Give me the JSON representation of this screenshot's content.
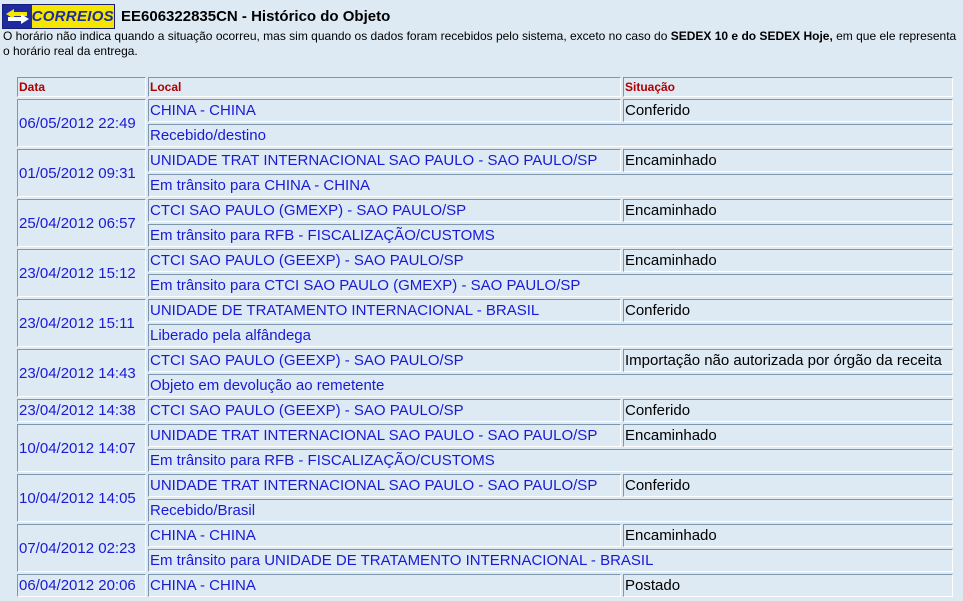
{
  "header": {
    "logo_text": "CORREIOS",
    "logo_colors": {
      "brand_blue": "#1d2aa0",
      "brand_yellow": "#f5e600"
    },
    "title": "EE606322835CN - Histórico do Objeto"
  },
  "note": {
    "text_1": "O horário não indica quando a situação ocorreu, mas sim quando os dados foram recebidos pelo sistema, exceto no caso do ",
    "bold": "SEDEX 10 e do SEDEX Hoje,",
    "text_2": " em que ele representa o horário real da entrega."
  },
  "table": {
    "headers": {
      "date": "Data",
      "location": "Local",
      "status": "Situação"
    },
    "rows": [
      {
        "date": "06/05/2012 22:49",
        "location": "CHINA - CHINA",
        "status": "Conferido",
        "detail": "Recebido/destino"
      },
      {
        "date": "01/05/2012 09:31",
        "location": "UNIDADE TRAT INTERNACIONAL SAO PAULO - SAO PAULO/SP",
        "status": "Encaminhado",
        "detail": "Em trânsito para CHINA - CHINA"
      },
      {
        "date": "25/04/2012 06:57",
        "location": "CTCI SAO PAULO (GMEXP) - SAO PAULO/SP",
        "status": "Encaminhado",
        "detail": "Em trânsito para RFB - FISCALIZAÇÃO/CUSTOMS"
      },
      {
        "date": "23/04/2012 15:12",
        "location": "CTCI SAO PAULO (GEEXP) - SAO PAULO/SP",
        "status": "Encaminhado",
        "detail": "Em trânsito para CTCI SAO PAULO (GMEXP) - SAO PAULO/SP"
      },
      {
        "date": "23/04/2012 15:11",
        "location": "UNIDADE DE TRATAMENTO INTERNACIONAL - BRASIL",
        "status": "Conferido",
        "detail": "Liberado pela alfândega"
      },
      {
        "date": "23/04/2012 14:43",
        "location": "CTCI SAO PAULO (GEEXP) - SAO PAULO/SP",
        "status": "Importação não autorizada por órgão da receita",
        "detail": "Objeto em devolução ao remetente"
      },
      {
        "date": "23/04/2012 14:38",
        "location": "CTCI SAO PAULO (GEEXP) - SAO PAULO/SP",
        "status": "Conferido",
        "detail": null
      },
      {
        "date": "10/04/2012 14:07",
        "location": "UNIDADE TRAT INTERNACIONAL SAO PAULO - SAO PAULO/SP",
        "status": "Encaminhado",
        "detail": "Em trânsito para RFB - FISCALIZAÇÃO/CUSTOMS"
      },
      {
        "date": "10/04/2012 14:05",
        "location": "UNIDADE TRAT INTERNACIONAL SAO PAULO - SAO PAULO/SP",
        "status": "Conferido",
        "detail": "Recebido/Brasil"
      },
      {
        "date": "07/04/2012 02:23",
        "location": "CHINA - CHINA",
        "status": "Encaminhado",
        "detail": "Em trânsito para UNIDADE DE TRATAMENTO INTERNACIONAL - BRASIL"
      },
      {
        "date": "06/04/2012 20:06",
        "location": "CHINA - CHINA",
        "status": "Postado",
        "detail": null
      }
    ]
  }
}
